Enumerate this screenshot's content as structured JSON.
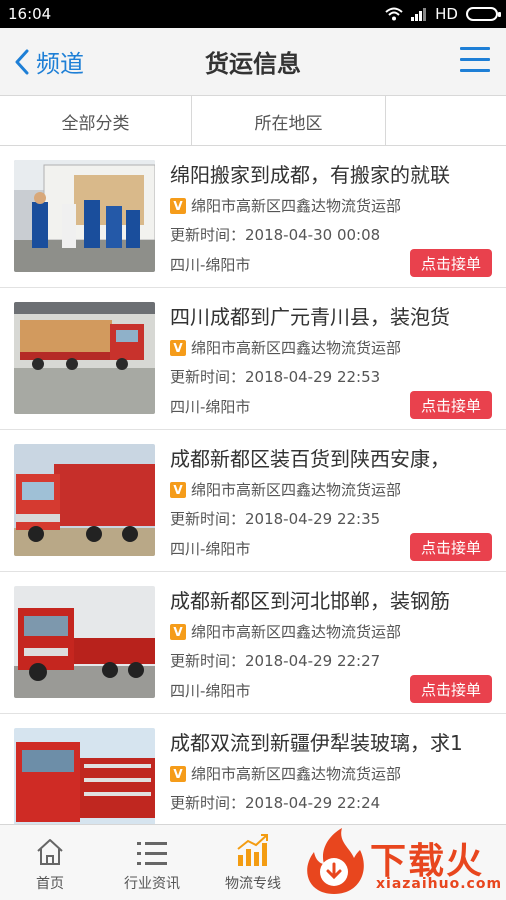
{
  "status": {
    "time": "16:04",
    "network": "HD"
  },
  "nav": {
    "back_label": "频道",
    "title": "货运信息"
  },
  "filters": [
    "全部分类",
    "所在地区",
    ""
  ],
  "colors": {
    "accent": "#1e7fd6",
    "button": "#e9414d",
    "badge": "#f59c1a",
    "watermark": "#e8461e"
  },
  "items": [
    {
      "title": "绵阳搬家到成都，有搬家的就联",
      "company": "绵阳市高新区四鑫达物流货运部",
      "update": "更新时间：2018-04-30 00:08",
      "region": "四川-绵阳市",
      "action": "点击接单",
      "badge": "V"
    },
    {
      "title": "四川成都到广元青川县，装泡货",
      "company": "绵阳市高新区四鑫达物流货运部",
      "update": "更新时间：2018-04-29 22:53",
      "region": "四川-绵阳市",
      "action": "点击接单",
      "badge": "V"
    },
    {
      "title": "成都新都区装百货到陕西安康，",
      "company": "绵阳市高新区四鑫达物流货运部",
      "update": "更新时间：2018-04-29 22:35",
      "region": "四川-绵阳市",
      "action": "点击接单",
      "badge": "V"
    },
    {
      "title": "成都新都区到河北邯郸，装钢筋",
      "company": "绵阳市高新区四鑫达物流货运部",
      "update": "更新时间：2018-04-29 22:27",
      "region": "四川-绵阳市",
      "action": "点击接单",
      "badge": "V"
    },
    {
      "title": "成都双流到新疆伊犁装玻璃，求1",
      "company": "绵阳市高新区四鑫达物流货运部",
      "update": "更新时间：2018-04-29 22:24",
      "region": "",
      "action": "",
      "badge": "V"
    }
  ],
  "tabs": [
    {
      "label": "首页",
      "icon": "home-icon"
    },
    {
      "label": "行业资讯",
      "icon": "list-icon"
    },
    {
      "label": "物流专线",
      "icon": "chart-icon"
    }
  ],
  "watermark": {
    "text": "下载火",
    "sub": "xiazaihuo.com"
  }
}
